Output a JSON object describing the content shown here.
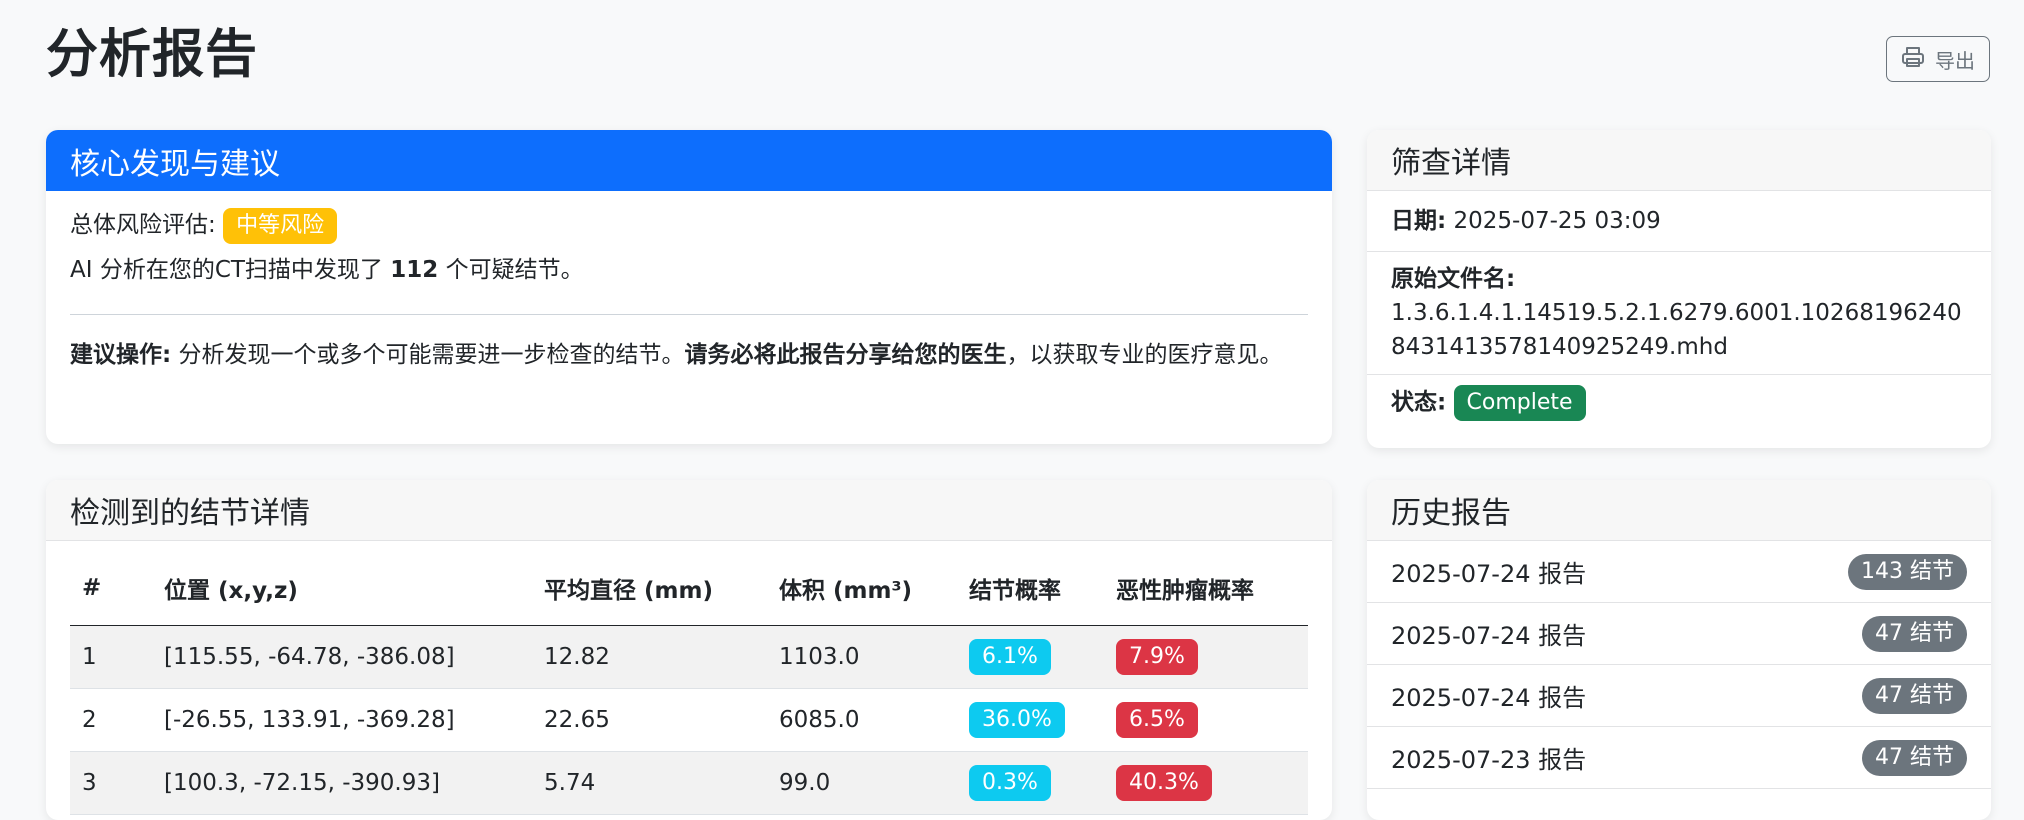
{
  "page": {
    "title": "分析报告",
    "export_label": "导出"
  },
  "findings": {
    "header": "核心发现与建议",
    "risk_label": "总体风险评估:",
    "risk_badge": "中等风险",
    "summary_prefix": "AI 分析在您的CT扫描中发现了",
    "nodule_count": "112",
    "summary_suffix": "个可疑结节。",
    "recommend_label": "建议操作:",
    "recommend_text": "分析发现一个或多个可能需要进一步检查的结节。",
    "recommend_bold": "请务必将此报告分享给您的医生",
    "recommend_tail": "，以获取专业的医疗意见。",
    "colors": {
      "header_bg": "#0d6efd",
      "risk_badge": "#ffc107"
    }
  },
  "details": {
    "header": "筛查详情",
    "date_label": "日期:",
    "date_value": "2025-07-25 03:09",
    "filename_label": "原始文件名:",
    "filename_value": "1.3.6.1.4.1.14519.5.2.1.6279.6001.102681962408431413578140925249.mhd",
    "status_label": "状态:",
    "status_value": "Complete",
    "colors": {
      "status_badge": "#198754"
    }
  },
  "nodules": {
    "header": "检测到的结节详情",
    "columns": [
      "#",
      "位置 (x,y,z)",
      "平均直径 (mm)",
      "体积 (mm³)",
      "结节概率",
      "恶性肿瘤概率"
    ],
    "rows": [
      {
        "id": "1",
        "position": "[115.55, -64.78, -386.08]",
        "diameter": "12.82",
        "volume": "1103.0",
        "nodule_prob": "6.1%",
        "malignancy_prob": "7.9%"
      },
      {
        "id": "2",
        "position": "[-26.55, 133.91, -369.28]",
        "diameter": "22.65",
        "volume": "6085.0",
        "nodule_prob": "36.0%",
        "malignancy_prob": "6.5%"
      },
      {
        "id": "3",
        "position": "[100.3, -72.15, -390.93]",
        "diameter": "5.74",
        "volume": "99.0",
        "nodule_prob": "0.3%",
        "malignancy_prob": "40.3%"
      }
    ],
    "colors": {
      "nodule_prob_badge": "#0dcaf0",
      "malignancy_badge": "#dc3545"
    }
  },
  "history": {
    "header": "历史报告",
    "items": [
      {
        "label": "2025-07-24 报告",
        "count": "143 结节"
      },
      {
        "label": "2025-07-24 报告",
        "count": "47 结节"
      },
      {
        "label": "2025-07-24 报告",
        "count": "47 结节"
      },
      {
        "label": "2025-07-23 报告",
        "count": "47 结节"
      }
    ]
  },
  "icons": {
    "export": "printer-icon"
  }
}
